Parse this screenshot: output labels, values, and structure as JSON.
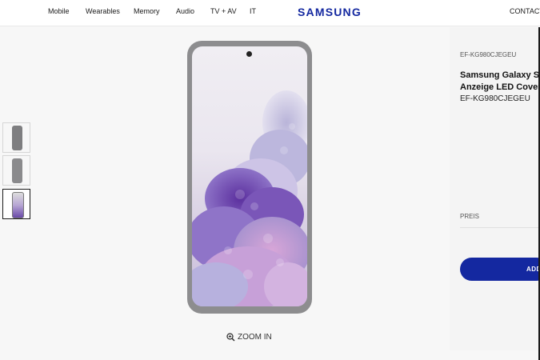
{
  "nav": {
    "items": [
      "Mobile",
      "Wearables",
      "Memory",
      "Audio",
      "TV + AV",
      "IT"
    ],
    "logo": "SAMSUNG",
    "contact": "CONTACT"
  },
  "gallery": {
    "thumbnails": [
      {
        "label": "grey back view",
        "active": false
      },
      {
        "label": "grey back view",
        "active": false
      },
      {
        "label": "front wallpaper view",
        "active": true
      }
    ],
    "zoom_label": "ZOOM IN"
  },
  "product": {
    "sku_small": "EF-KG980CJEGEU",
    "title_line1": "Samsung Galaxy S",
    "title_line2": "Anzeige LED Cover",
    "sku": "EF-KG980CJEGEU",
    "price_label": "PREIS",
    "add_button": "ADD"
  },
  "colors": {
    "brand_blue": "#1428a0",
    "case_grey": "#8d8d8f"
  }
}
